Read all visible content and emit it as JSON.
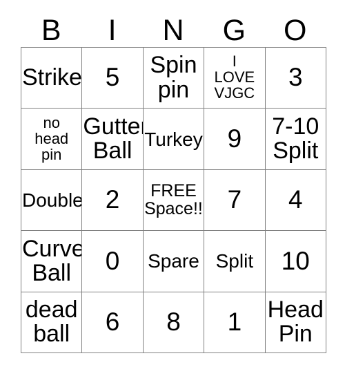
{
  "card": {
    "type": "bingo-card",
    "theme": "bowling",
    "columns": 5,
    "rows": 5,
    "border_color": "#808080",
    "text_color": "#000000",
    "background_color": "#ffffff",
    "header": {
      "letters": [
        "B",
        "I",
        "N",
        "G",
        "O"
      ]
    },
    "grid": [
      [
        {
          "text": "Strike",
          "size": "lg"
        },
        {
          "text": "5",
          "size": "xl"
        },
        {
          "text": "Spin\npin",
          "size": "lg"
        },
        {
          "text": "I\nLOVE\nVJGC",
          "size": "xs"
        },
        {
          "text": "3",
          "size": "xl"
        }
      ],
      [
        {
          "text": "no\nhead\npin",
          "size": "xs"
        },
        {
          "text": "Gutter\nBall",
          "size": "lg"
        },
        {
          "text": "Turkey",
          "size": "md"
        },
        {
          "text": "9",
          "size": "xl"
        },
        {
          "text": "7-10\nSplit",
          "size": "lg"
        }
      ],
      [
        {
          "text": "Double",
          "size": "md"
        },
        {
          "text": "2",
          "size": "xl"
        },
        {
          "text": "FREE\nSpace!!",
          "size": "sm"
        },
        {
          "text": "7",
          "size": "xl"
        },
        {
          "text": "4",
          "size": "xl"
        }
      ],
      [
        {
          "text": "Curve\nBall",
          "size": "lg"
        },
        {
          "text": "0",
          "size": "xl"
        },
        {
          "text": "Spare",
          "size": "md"
        },
        {
          "text": "Split",
          "size": "md"
        },
        {
          "text": "10",
          "size": "xl"
        }
      ],
      [
        {
          "text": "dead\nball",
          "size": "lg"
        },
        {
          "text": "6",
          "size": "xl"
        },
        {
          "text": "8",
          "size": "xl"
        },
        {
          "text": "1",
          "size": "xl"
        },
        {
          "text": "Head\nPin",
          "size": "lg"
        }
      ]
    ]
  }
}
